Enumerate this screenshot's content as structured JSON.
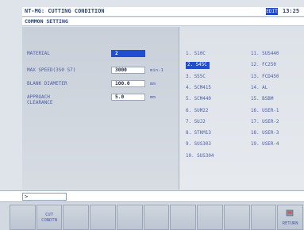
{
  "header": {
    "title": "NT-MG: CUTTING CONDITION",
    "mode_badge": "EDIT",
    "clock": "13:25",
    "section": "COMMON SETTING"
  },
  "params": [
    {
      "label": "MATERIAL",
      "value": "2",
      "unit": "",
      "selected": true
    },
    {
      "label": "MAX SPEED(3S0 S7)",
      "value": "3000",
      "unit": "min-1",
      "selected": false
    },
    {
      "label": "BLANK DIAMETER",
      "value": "100.0",
      "unit": "mm",
      "selected": false
    },
    {
      "label": "APPROACH\nCLEARANCE",
      "value": "5.0",
      "unit": "mm",
      "selected": false
    }
  ],
  "materials_col1": [
    "1. S10C",
    "2. S45C",
    "3. S55C",
    "4. SCM415",
    "5. SCM440",
    "6. SUM22",
    "7. SUJ2",
    "8. STKM13",
    "9. SUS303",
    "10. SUS304"
  ],
  "materials_col2": [
    "11. SUS440",
    "12. FC250",
    "13. FCD450",
    "14. AL",
    "15. BSBM",
    "16. USER-1",
    "17. USER-2",
    "18. USER-3",
    "19. USER-4"
  ],
  "selected_material_index": 1,
  "input": {
    "prompt": ">"
  },
  "softkeys": [
    "",
    "CUT\nCONDTN",
    "",
    "",
    "",
    "",
    "",
    "",
    "",
    "",
    "RETURN"
  ],
  "colors": {
    "accent": "#1f4ed0",
    "label": "#4a5dab"
  },
  "icons": {
    "return": "return-icon"
  }
}
